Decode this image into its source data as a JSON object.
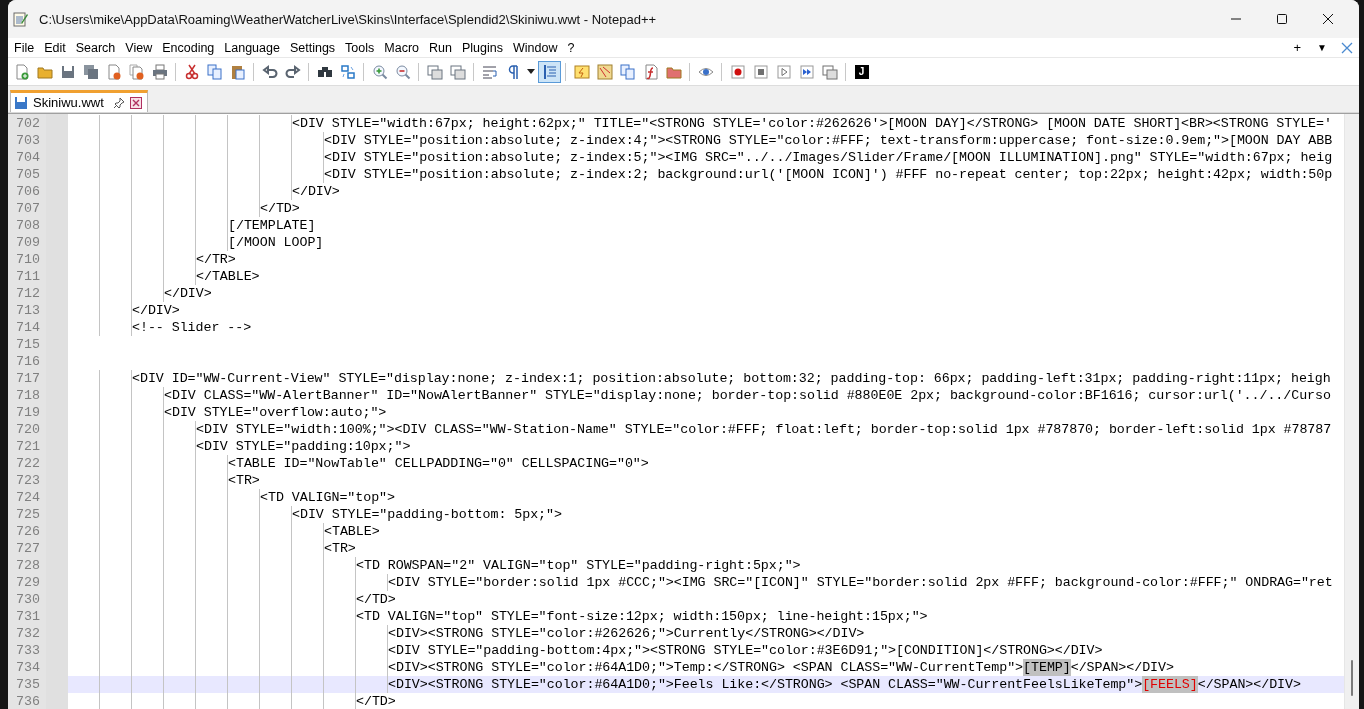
{
  "window": {
    "title": "C:\\Users\\mike\\AppData\\Roaming\\WeatherWatcherLive\\Skins\\Interface\\Splendid2\\Skiniwu.wwt - Notepad++"
  },
  "menu_bar": {
    "items": [
      "File",
      "Edit",
      "Search",
      "View",
      "Encoding",
      "Language",
      "Settings",
      "Tools",
      "Macro",
      "Run",
      "Plugins",
      "Window",
      "?"
    ],
    "controls": [
      "+",
      "▼"
    ]
  },
  "toolbar": [
    [
      {
        "kind": "new",
        "selected": false
      },
      {
        "kind": "open",
        "selected": false
      },
      {
        "kind": "save",
        "selected": false
      },
      {
        "kind": "save-all",
        "selected": false
      },
      {
        "kind": "close",
        "selected": false
      },
      {
        "kind": "close-all",
        "selected": false
      },
      {
        "kind": "print",
        "selected": false
      }
    ],
    [
      {
        "kind": "cut",
        "selected": false
      },
      {
        "kind": "copy",
        "selected": false
      },
      {
        "kind": "paste",
        "selected": false
      }
    ],
    [
      {
        "kind": "undo",
        "selected": false
      },
      {
        "kind": "redo",
        "selected": false
      }
    ],
    [
      {
        "kind": "find",
        "selected": false
      },
      {
        "kind": "replace",
        "selected": false
      }
    ],
    [
      {
        "kind": "zoom-in",
        "selected": false
      },
      {
        "kind": "zoom-out",
        "selected": false
      }
    ],
    [
      {
        "kind": "sync-v",
        "selected": false
      },
      {
        "kind": "sync-h",
        "selected": false
      }
    ],
    [
      {
        "kind": "wrap",
        "selected": false
      },
      {
        "kind": "all-chars",
        "selected": false
      },
      {
        "kind": "dropdown",
        "selected": false
      },
      {
        "kind": "indent-guide",
        "selected": true
      }
    ],
    [
      {
        "kind": "lang",
        "selected": false
      },
      {
        "kind": "map",
        "selected": false
      },
      {
        "kind": "panel",
        "selected": false
      },
      {
        "kind": "function",
        "selected": false
      },
      {
        "kind": "folder",
        "selected": false
      }
    ],
    [
      {
        "kind": "monitor",
        "selected": false
      }
    ],
    [
      {
        "kind": "record",
        "selected": false
      },
      {
        "kind": "stop",
        "selected": false
      },
      {
        "kind": "play",
        "selected": false
      },
      {
        "kind": "play-multi",
        "selected": false
      },
      {
        "kind": "save-macro",
        "selected": false
      }
    ],
    [
      {
        "kind": "plugin",
        "selected": false,
        "label": "J"
      }
    ]
  ],
  "tabs": [
    {
      "label": "Skiniwu.wwt",
      "selected": true
    }
  ],
  "editor": {
    "lines": [
      {
        "number": "702",
        "text": "                            <DIV STYLE=\"width:67px; height:62px;\" TITLE=\"<STRONG STYLE='color:#262626'>[MOON DAY]</STRONG> [MOON DATE SHORT]<BR><STRONG STYLE='",
        "current": false
      },
      {
        "number": "703",
        "text": "                                <DIV STYLE=\"position:absolute; z-index:4;\"><STRONG STYLE=\"color:#FFF; text-transform:uppercase; font-size:0.9em;\">[MOON DAY ABB",
        "current": false
      },
      {
        "number": "704",
        "text": "                                <DIV STYLE=\"position:absolute; z-index:5;\"><IMG SRC=\"../../Images/Slider/Frame/[MOON ILLUMINATION].png\" STYLE=\"width:67px; heig",
        "current": false
      },
      {
        "number": "705",
        "text": "                                <DIV STYLE=\"position:absolute; z-index:2; background:url('[MOON ICON]') #FFF no-repeat center; top:22px; height:42px; width:50p",
        "current": false
      },
      {
        "number": "706",
        "text": "                            </DIV>",
        "current": false
      },
      {
        "number": "707",
        "text": "                        </TD>",
        "current": false
      },
      {
        "number": "708",
        "text": "                    [/TEMPLATE]",
        "current": false
      },
      {
        "number": "709",
        "text": "                    [/MOON LOOP]",
        "current": false
      },
      {
        "number": "710",
        "text": "                </TR>",
        "current": false
      },
      {
        "number": "711",
        "text": "                </TABLE>",
        "current": false
      },
      {
        "number": "712",
        "text": "            </DIV>",
        "current": false
      },
      {
        "number": "713",
        "text": "        </DIV>",
        "current": false
      },
      {
        "number": "714",
        "text": "        <!-- Slider -->",
        "current": false
      },
      {
        "number": "715",
        "current": false
      },
      {
        "number": "716",
        "current": false
      },
      {
        "number": "717",
        "text": "        <DIV ID=\"WW-Current-View\" STYLE=\"display:none; z-index:1; position:absolute; bottom:32; padding-top: 66px; padding-left:31px; padding-right:11px; heigh",
        "current": false
      },
      {
        "number": "718",
        "text": "            <DIV CLASS=\"WW-AlertBanner\" ID=\"NowAlertBanner\" STYLE=\"display:none; border-top:solid #880E0E 2px; background-color:BF1616; cursor:url('../../Curso",
        "current": false
      },
      {
        "number": "719",
        "text": "            <DIV STYLE=\"overflow:auto;\">",
        "current": false
      },
      {
        "number": "720",
        "text": "                <DIV STYLE=\"width:100%;\"><DIV CLASS=\"WW-Station-Name\" STYLE=\"color:#FFF; float:left; border-top:solid 1px #787870; border-left:solid 1px #78787",
        "current": false
      },
      {
        "number": "721",
        "text": "                <DIV STYLE=\"padding:10px;\">",
        "current": false
      },
      {
        "number": "722",
        "text": "                    <TABLE ID=\"NowTable\" CELLPADDING=\"0\" CELLSPACING=\"0\">",
        "current": false
      },
      {
        "number": "723",
        "text": "                    <TR>",
        "current": false
      },
      {
        "number": "724",
        "text": "                        <TD VALIGN=\"top\">",
        "current": false
      },
      {
        "number": "725",
        "text": "                            <DIV STYLE=\"padding-bottom: 5px;\">",
        "current": false
      },
      {
        "number": "726",
        "text": "                                <TABLE>",
        "current": false
      },
      {
        "number": "727",
        "text": "                                <TR>",
        "current": false
      },
      {
        "number": "728",
        "text": "                                    <TD ROWSPAN=\"2\" VALIGN=\"top\" STYLE=\"padding-right:5px;\">",
        "current": false
      },
      {
        "number": "729",
        "text": "                                        <DIV STYLE=\"border:solid 1px #CCC;\"><IMG SRC=\"[ICON]\" STYLE=\"border:solid 2px #FFF; background-color:#FFF;\" ONDRAG=\"ret",
        "current": false
      },
      {
        "number": "730",
        "text": "                                    </TD>",
        "current": false
      },
      {
        "number": "731",
        "text": "                                    <TD VALIGN=\"top\" STYLE=\"font-size:12px; width:150px; line-height:15px;\">",
        "current": false
      },
      {
        "number": "732",
        "text": "                                        <DIV><STRONG STYLE=\"color:#262626;\">Currently</STRONG></DIV>",
        "current": false
      },
      {
        "number": "733",
        "text": "                                        <DIV STYLE=\"padding-bottom:4px;\"><STRONG STYLE=\"color:#3E6D91;\">[CONDITION]</STRONG></DIV>",
        "current": false
      },
      {
        "number": "734",
        "parts": [
          {
            "kind": "plain",
            "text": "                                        <DIV><STRONG STYLE=\"color:#64A1D0;\">Temp:</STRONG> <SPAN CLASS=\"WW-CurrentTemp\">"
          },
          {
            "kind": "match",
            "text": "[TEMP]"
          },
          {
            "kind": "plain",
            "text": "</SPAN></DIV>"
          }
        ],
        "current": false
      },
      {
        "number": "735",
        "parts": [
          {
            "kind": "plain",
            "text": "                                        <DIV><STRONG STYLE=\"color:#64A1D0;\">Feels Like:</STRONG> <SPAN CLASS=\"WW-CurrentFeelsLikeTemp\">"
          },
          {
            "kind": "brace-match",
            "text": "[FEELS]"
          },
          {
            "kind": "plain",
            "text": "</SPAN></DIV>"
          }
        ],
        "current": true
      },
      {
        "number": "736",
        "text": "                                    </TD>",
        "current": false
      }
    ]
  }
}
